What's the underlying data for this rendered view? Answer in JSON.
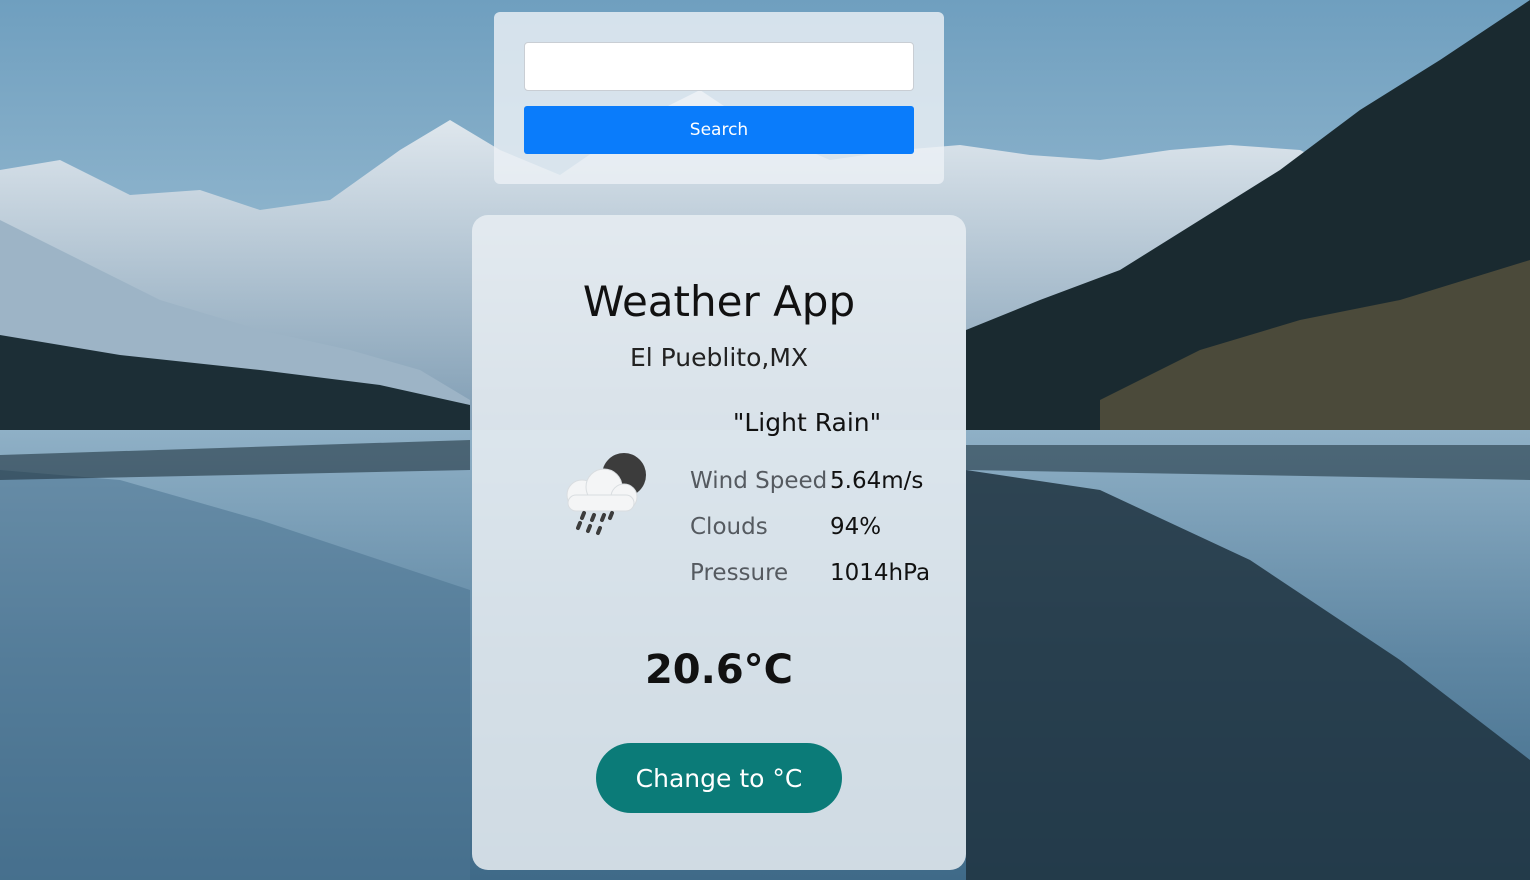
{
  "search": {
    "input_value": "",
    "input_placeholder": "",
    "button_label": "Search"
  },
  "weather": {
    "app_title": "Weather App",
    "location": "El Pueblito,MX",
    "condition": "\"Light Rain\"",
    "icon": "rain-cloud-moon-icon",
    "stats": [
      {
        "label": "Wind Speed",
        "value": "5.64m/s"
      },
      {
        "label": "Clouds",
        "value": "94%"
      },
      {
        "label": "Pressure",
        "value": "1014hPa"
      }
    ],
    "temperature": "20.6°C",
    "toggle_label": "Change to °C"
  },
  "colors": {
    "search_button": "#0a7cfb",
    "toggle_button": "#0b7b78",
    "panel_background": "#e8edf2"
  }
}
